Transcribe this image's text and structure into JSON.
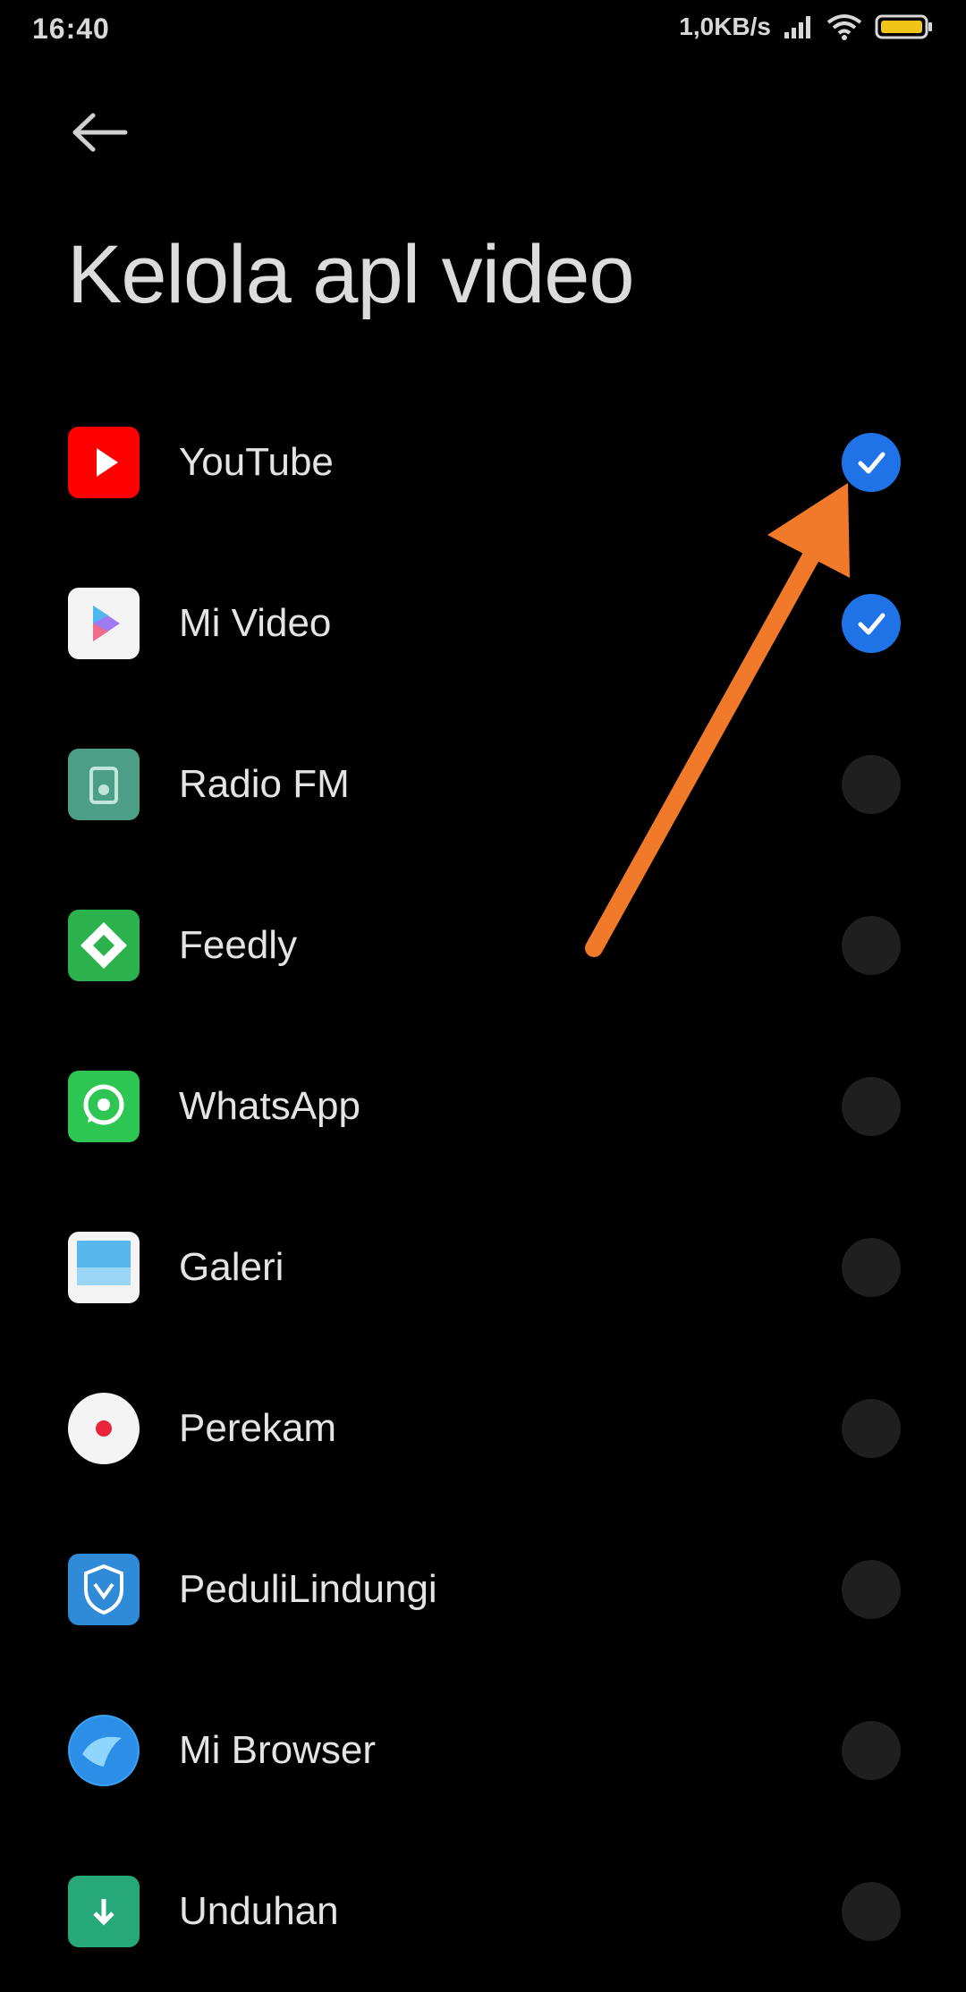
{
  "status_bar": {
    "time": "16:40",
    "net_speed": "1,0KB/s"
  },
  "header": {
    "back_icon": "arrow-left-icon",
    "title": "Kelola apl video"
  },
  "apps": [
    {
      "name": "YouTube",
      "icon": "youtube-icon",
      "checked": true
    },
    {
      "name": "Mi Video",
      "icon": "mi-video-icon",
      "checked": true
    },
    {
      "name": "Radio FM",
      "icon": "radio-fm-icon",
      "checked": false
    },
    {
      "name": "Feedly",
      "icon": "feedly-icon",
      "checked": false
    },
    {
      "name": "WhatsApp",
      "icon": "whatsapp-icon",
      "checked": false
    },
    {
      "name": "Galeri",
      "icon": "gallery-icon",
      "checked": false
    },
    {
      "name": "Perekam",
      "icon": "recorder-icon",
      "checked": false
    },
    {
      "name": "PeduliLindungi",
      "icon": "pedulilindungi-icon",
      "checked": false
    },
    {
      "name": "Mi Browser",
      "icon": "mi-browser-icon",
      "checked": false
    },
    {
      "name": "Unduhan",
      "icon": "downloads-icon",
      "checked": false
    }
  ],
  "colors": {
    "background": "#000000",
    "accent": "#1f73e6",
    "annotation_arrow": "#f07a2a",
    "unchecked": "#1f1f1f"
  }
}
